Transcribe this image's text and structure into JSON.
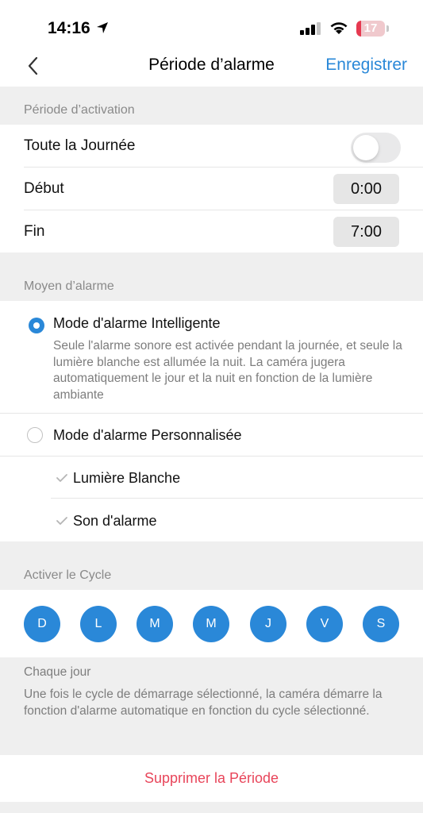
{
  "status": {
    "time": "14:16",
    "battery": "17",
    "battery_level": 0.17,
    "icons": [
      "location-arrow-icon",
      "signal-icon",
      "wifi-icon",
      "battery-icon"
    ]
  },
  "nav": {
    "back_icon": "chevron-left-icon",
    "title": "Période d’alarme",
    "save_label": "Enregistrer"
  },
  "activation": {
    "header": "Période d’activation",
    "all_day_label": "Toute la Journée",
    "all_day_on": false,
    "start_label": "Début",
    "start_value": "0:00",
    "end_label": "Fin",
    "end_value": "7:00"
  },
  "alarm_mode": {
    "header": "Moyen d’alarme",
    "smart": {
      "title": "Mode d'alarme Intelligente",
      "description": "Seule l'alarme sonore est activée pendant la journée, et seule la lumière blanche est allumée la nuit. La caméra jugera automatiquement le jour et la nuit en fonction de la lumière ambiante",
      "selected": true
    },
    "custom": {
      "title": "Mode d'alarme Personnalisée",
      "selected": false,
      "options": [
        {
          "label": "Lumière Blanche",
          "icon": "check-icon"
        },
        {
          "label": "Son d'alarme",
          "icon": "check-icon"
        }
      ]
    }
  },
  "cycle": {
    "header": "Activer le Cycle",
    "days": [
      "D",
      "L",
      "M",
      "M",
      "J",
      "V",
      "S"
    ],
    "summary_title": "Chaque jour",
    "summary_text": "Une fois le cycle de démarrage sélectionné, la caméra démarre la fonction d'alarme automatique en fonction du cycle sélectionné."
  },
  "delete_label": "Supprimer la Période",
  "colors": {
    "accent": "#2a88d8",
    "danger": "#e8455a",
    "background": "#efefef"
  }
}
